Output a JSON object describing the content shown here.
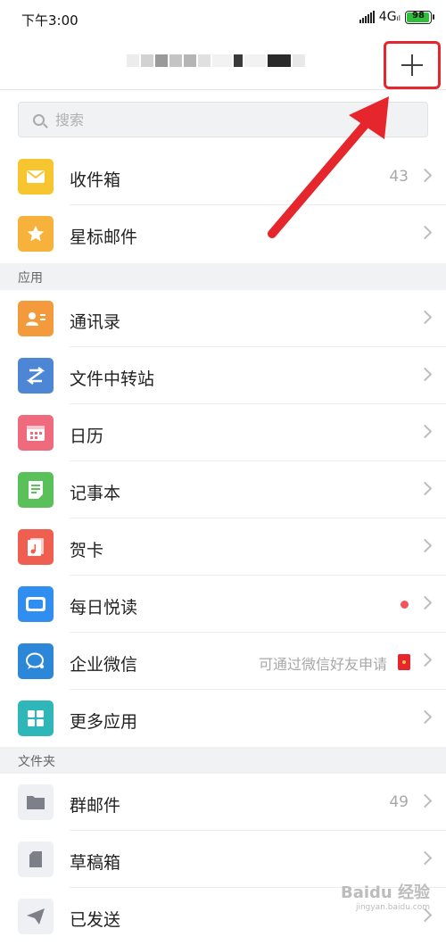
{
  "status_bar": {
    "time": "下午3:00",
    "network": "4G",
    "battery": "98"
  },
  "header": {
    "account_name": ""
  },
  "search": {
    "placeholder": "搜索"
  },
  "mail": [
    {
      "label": "收件箱",
      "count": "43",
      "icon": "inbox-icon",
      "color": "#f7c52f"
    },
    {
      "label": "星标邮件",
      "icon": "star-icon",
      "color": "#f6b23a"
    }
  ],
  "sections": {
    "apps": "应用",
    "folders": "文件夹"
  },
  "apps": [
    {
      "label": "通讯录",
      "icon": "contacts-icon",
      "color": "#f39b3c"
    },
    {
      "label": "文件中转站",
      "icon": "transfer-icon",
      "color": "#4e86d6"
    },
    {
      "label": "日历",
      "icon": "calendar-icon",
      "color": "#f06a7d"
    },
    {
      "label": "记事本",
      "icon": "notepad-icon",
      "color": "#59c05a"
    },
    {
      "label": "贺卡",
      "icon": "card-icon",
      "color": "#ef5e4f"
    },
    {
      "label": "每日悦读",
      "icon": "reading-icon",
      "color": "#2f8ef0"
    },
    {
      "label": "企业微信",
      "hint": "可通过微信好友申请",
      "icon": "wecom-icon",
      "color": "#2d87d8"
    },
    {
      "label": "更多应用",
      "icon": "more-apps-icon",
      "color": "#2fb6b8"
    }
  ],
  "folders": [
    {
      "label": "群邮件",
      "count": "49",
      "icon": "folder-icon"
    },
    {
      "label": "草稿箱",
      "icon": "draft-icon"
    },
    {
      "label": "已发送",
      "icon": "sent-icon"
    }
  ],
  "colors": {
    "accent_red": "#e5272d",
    "folder_icon_bg": "#eef0f3"
  },
  "watermark": {
    "line1": "Baidu 经验",
    "line2": "jingyan.baidu.com"
  }
}
